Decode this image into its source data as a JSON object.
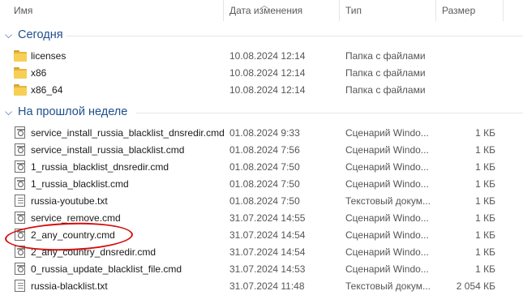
{
  "columns": {
    "name": "Имя",
    "date": "Дата изменения",
    "type": "Тип",
    "size": "Размер"
  },
  "groups": [
    {
      "title": "Сегодня"
    },
    {
      "title": "На прошлой неделе"
    }
  ],
  "today": [
    {
      "name": "licenses",
      "date": "10.08.2024 12:14",
      "type": "Папка с файлами",
      "size": ""
    },
    {
      "name": "x86",
      "date": "10.08.2024 12:14",
      "type": "Папка с файлами",
      "size": ""
    },
    {
      "name": "x86_64",
      "date": "10.08.2024 12:14",
      "type": "Папка с файлами",
      "size": ""
    }
  ],
  "last_week": [
    {
      "name": "service_install_russia_blacklist_dnsredir.cmd",
      "date": "01.08.2024 9:33",
      "type": "Сценарий Windo...",
      "size": "1 КБ"
    },
    {
      "name": "service_install_russia_blacklist.cmd",
      "date": "01.08.2024 7:56",
      "type": "Сценарий Windo...",
      "size": "1 КБ"
    },
    {
      "name": "1_russia_blacklist_dnsredir.cmd",
      "date": "01.08.2024 7:50",
      "type": "Сценарий Windo...",
      "size": "1 КБ"
    },
    {
      "name": "1_russia_blacklist.cmd",
      "date": "01.08.2024 7:50",
      "type": "Сценарий Windo...",
      "size": "1 КБ"
    },
    {
      "name": "russia-youtube.txt",
      "date": "01.08.2024 7:50",
      "type": "Текстовый докум...",
      "size": "1 КБ"
    },
    {
      "name": "service_remove.cmd",
      "date": "31.07.2024 14:55",
      "type": "Сценарий Windo...",
      "size": "1 КБ"
    },
    {
      "name": "2_any_country.cmd",
      "date": "31.07.2024 14:54",
      "type": "Сценарий Windo...",
      "size": "1 КБ"
    },
    {
      "name": "2_any_country_dnsredir.cmd",
      "date": "31.07.2024 14:54",
      "type": "Сценарий Windo...",
      "size": "1 КБ"
    },
    {
      "name": "0_russia_update_blacklist_file.cmd",
      "date": "31.07.2024 14:53",
      "type": "Сценарий Windo...",
      "size": "1 КБ"
    },
    {
      "name": "russia-blacklist.txt",
      "date": "31.07.2024 11:48",
      "type": "Текстовый докум...",
      "size": "2 054 КБ"
    }
  ],
  "icons": {
    "folder": "folder-icon",
    "cmd": "cmd-script-icon",
    "txt": "text-file-icon"
  },
  "colors": {
    "group_title": "#1f4e8c",
    "annotation": "#d40f0f",
    "folder": "#f6cf55"
  }
}
